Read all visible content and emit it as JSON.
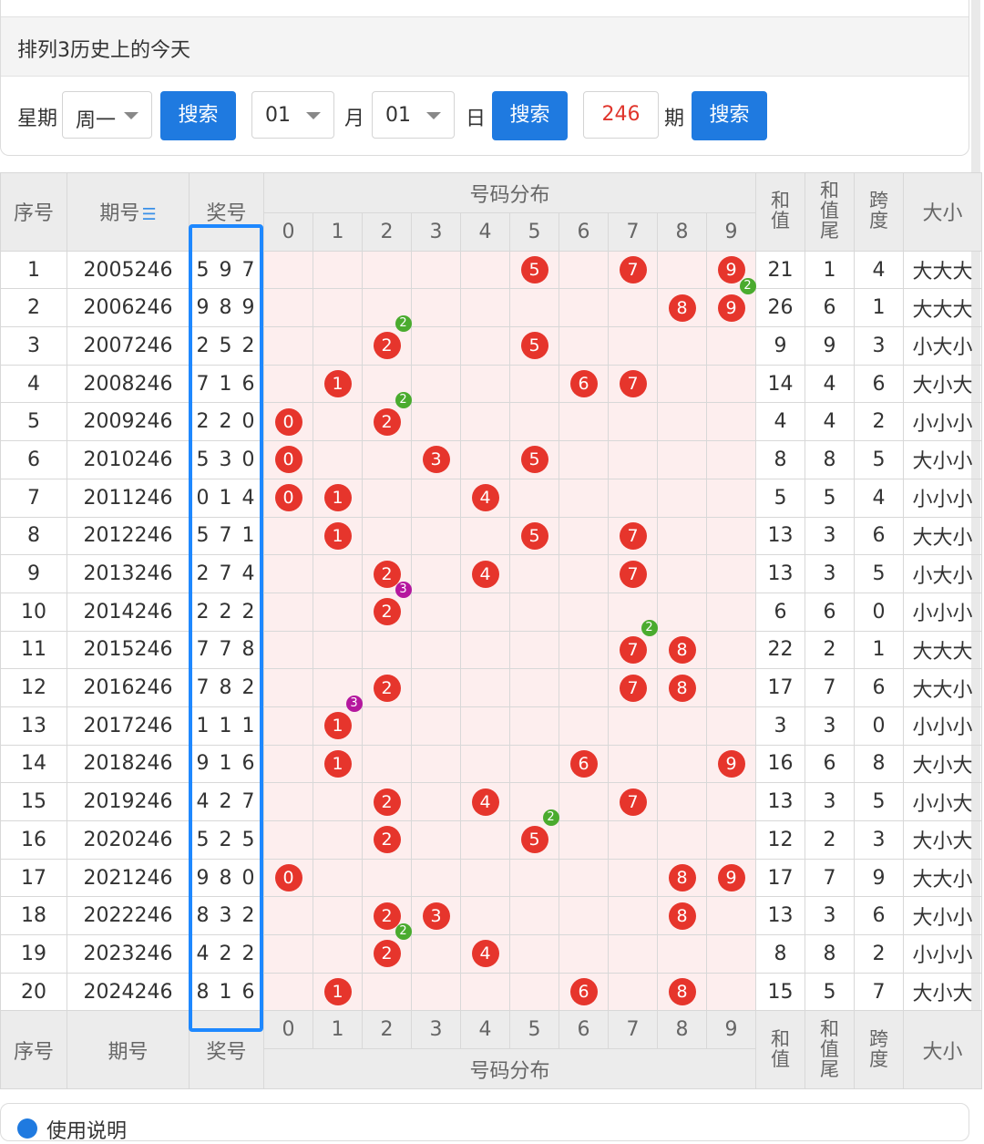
{
  "header": {
    "title": "排列3历史上的今天"
  },
  "toolbar": {
    "weekday_label": "星期",
    "weekday_value": "周一",
    "search1": "搜索",
    "month_value": "01",
    "month_label": "月",
    "day_value": "01",
    "day_label": "日",
    "search2": "搜索",
    "issue_value": "246",
    "issue_label": "期",
    "search3": "搜索"
  },
  "table": {
    "headers": {
      "seq": "序号",
      "period": "期号",
      "period_sort_icon": "sort-icon",
      "prize": "奖号",
      "distribution": "号码分布",
      "digits": [
        "0",
        "1",
        "2",
        "3",
        "4",
        "5",
        "6",
        "7",
        "8",
        "9"
      ],
      "sum": "和值",
      "sum_tail": "和值尾",
      "span": "跨度",
      "size": "大小"
    },
    "footer": {
      "seq": "序号",
      "period": "期号",
      "prize": "奖号",
      "distribution": "号码分布",
      "sum": "和值",
      "sum_tail": "和值尾",
      "span": "跨度",
      "size": "大小"
    },
    "rows": [
      {
        "seq": "1",
        "period": "2005246",
        "prize": "5 9 7",
        "sum": "21",
        "tail": "1",
        "span": "4",
        "size": "大大大",
        "balls": [
          5,
          7,
          9
        ],
        "badges": {}
      },
      {
        "seq": "2",
        "period": "2006246",
        "prize": "9 8 9",
        "sum": "26",
        "tail": "6",
        "span": "1",
        "size": "大大大",
        "balls": [
          8,
          9
        ],
        "badges": {
          "9": {
            "n": "2",
            "c": "green"
          }
        }
      },
      {
        "seq": "3",
        "period": "2007246",
        "prize": "2 5 2",
        "sum": "9",
        "tail": "9",
        "span": "3",
        "size": "小大小",
        "balls": [
          2,
          5
        ],
        "badges": {
          "2": {
            "n": "2",
            "c": "green"
          }
        }
      },
      {
        "seq": "4",
        "period": "2008246",
        "prize": "7 1 6",
        "sum": "14",
        "tail": "4",
        "span": "6",
        "size": "大小大",
        "balls": [
          1,
          6,
          7
        ],
        "badges": {}
      },
      {
        "seq": "5",
        "period": "2009246",
        "prize": "2 2 0",
        "sum": "4",
        "tail": "4",
        "span": "2",
        "size": "小小小",
        "balls": [
          0,
          2
        ],
        "badges": {
          "2": {
            "n": "2",
            "c": "green"
          }
        }
      },
      {
        "seq": "6",
        "period": "2010246",
        "prize": "5 3 0",
        "sum": "8",
        "tail": "8",
        "span": "5",
        "size": "大小小",
        "balls": [
          0,
          3,
          5
        ],
        "badges": {}
      },
      {
        "seq": "7",
        "period": "2011246",
        "prize": "0 1 4",
        "sum": "5",
        "tail": "5",
        "span": "4",
        "size": "小小小",
        "balls": [
          0,
          1,
          4
        ],
        "badges": {}
      },
      {
        "seq": "8",
        "period": "2012246",
        "prize": "5 7 1",
        "sum": "13",
        "tail": "3",
        "span": "6",
        "size": "大大小",
        "balls": [
          1,
          5,
          7
        ],
        "badges": {}
      },
      {
        "seq": "9",
        "period": "2013246",
        "prize": "2 7 4",
        "sum": "13",
        "tail": "3",
        "span": "5",
        "size": "小大小",
        "balls": [
          2,
          4,
          7
        ],
        "badges": {}
      },
      {
        "seq": "10",
        "period": "2014246",
        "prize": "2 2 2",
        "sum": "6",
        "tail": "6",
        "span": "0",
        "size": "小小小",
        "balls": [
          2
        ],
        "badges": {
          "2": {
            "n": "3",
            "c": "purple"
          }
        }
      },
      {
        "seq": "11",
        "period": "2015246",
        "prize": "7 7 8",
        "sum": "22",
        "tail": "2",
        "span": "1",
        "size": "大大大",
        "balls": [
          7,
          8
        ],
        "badges": {
          "7": {
            "n": "2",
            "c": "green"
          }
        }
      },
      {
        "seq": "12",
        "period": "2016246",
        "prize": "7 8 2",
        "sum": "17",
        "tail": "7",
        "span": "6",
        "size": "大大小",
        "balls": [
          2,
          7,
          8
        ],
        "badges": {}
      },
      {
        "seq": "13",
        "period": "2017246",
        "prize": "1 1 1",
        "sum": "3",
        "tail": "3",
        "span": "0",
        "size": "小小小",
        "balls": [
          1
        ],
        "badges": {
          "1": {
            "n": "3",
            "c": "purple"
          }
        }
      },
      {
        "seq": "14",
        "period": "2018246",
        "prize": "9 1 6",
        "sum": "16",
        "tail": "6",
        "span": "8",
        "size": "大小大",
        "balls": [
          1,
          6,
          9
        ],
        "badges": {}
      },
      {
        "seq": "15",
        "period": "2019246",
        "prize": "4 2 7",
        "sum": "13",
        "tail": "3",
        "span": "5",
        "size": "小小大",
        "balls": [
          2,
          4,
          7
        ],
        "badges": {}
      },
      {
        "seq": "16",
        "period": "2020246",
        "prize": "5 2 5",
        "sum": "12",
        "tail": "2",
        "span": "3",
        "size": "大小大",
        "balls": [
          2,
          5
        ],
        "badges": {
          "5": {
            "n": "2",
            "c": "green"
          }
        }
      },
      {
        "seq": "17",
        "period": "2021246",
        "prize": "9 8 0",
        "sum": "17",
        "tail": "7",
        "span": "9",
        "size": "大大小",
        "balls": [
          0,
          8,
          9
        ],
        "badges": {}
      },
      {
        "seq": "18",
        "period": "2022246",
        "prize": "8 3 2",
        "sum": "13",
        "tail": "3",
        "span": "6",
        "size": "大小小",
        "balls": [
          2,
          3,
          8
        ],
        "badges": {}
      },
      {
        "seq": "19",
        "period": "2023246",
        "prize": "4 2 2",
        "sum": "8",
        "tail": "8",
        "span": "2",
        "size": "小小小",
        "balls": [
          2,
          4
        ],
        "badges": {
          "2": {
            "n": "2",
            "c": "green"
          }
        }
      },
      {
        "seq": "20",
        "period": "2024246",
        "prize": "8 1 6",
        "sum": "15",
        "tail": "5",
        "span": "7",
        "size": "大小大",
        "balls": [
          1,
          6,
          8
        ],
        "badges": {}
      }
    ]
  },
  "footer_panel": {
    "text": "使用说明",
    "icon": "info-icon"
  },
  "colors": {
    "accent": "#1f7ae0",
    "ball": "#e6352c",
    "badge_green": "#4aab2e",
    "badge_purple": "#b5179e",
    "highlight": "#1e88ff"
  }
}
